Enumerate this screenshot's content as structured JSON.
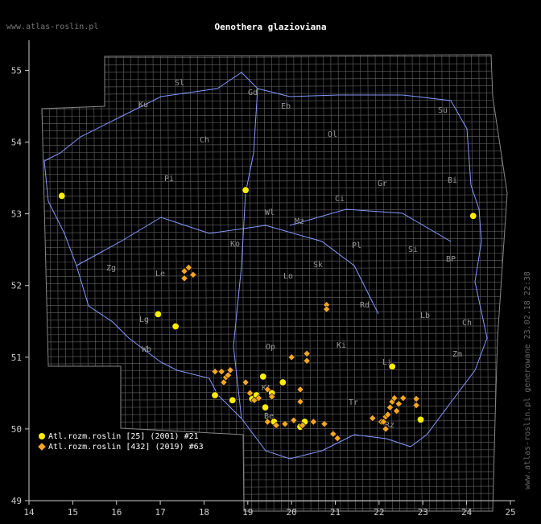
{
  "header": {
    "site": "www.atlas-roslin.pl",
    "title": "Oenothera glazioviana"
  },
  "side_note": "www.atlas-roslin.pl generowane 23.02.18 22:38",
  "axes": {
    "x_labels": [
      "14",
      "15",
      "16",
      "17",
      "18",
      "19",
      "20",
      "21",
      "22",
      "23",
      "24",
      "25"
    ],
    "y_labels": [
      "55",
      "54",
      "53",
      "52",
      "51",
      "50",
      "49"
    ]
  },
  "regions": [
    "Sl",
    "Gd",
    "Eb",
    "Ku",
    "Su",
    "Ch",
    "Ol",
    "Pi",
    "Ci",
    "Bi",
    "Gr",
    "Wl",
    "Mz",
    "Ko",
    "Pl",
    "Si",
    "Sk",
    "BP",
    "Zg",
    "Le",
    "Lo",
    "Rd",
    "Lb",
    "Ch",
    "Lg",
    "Wb",
    "Ki",
    "Zm",
    "Op",
    "Kt",
    "Tr",
    "Rz",
    "Be",
    "Li"
  ],
  "colors": {
    "grid": "#888888",
    "border": "#8899ff",
    "river": "#8899ff",
    "region_text": "#999999",
    "marker_old": "#ffee00",
    "marker_new": "#f5a623"
  },
  "legend": [
    {
      "label": "Atl.rozm.roslin [25] (2001) #21",
      "shape": "circle",
      "color": "#ffee00"
    },
    {
      "label": "Atl.rozm.roslin [432] (2019) #63",
      "shape": "diamond",
      "color": "#f5a623"
    }
  ],
  "points_circle": [
    [
      14.75,
      53.25
    ],
    [
      18.95,
      53.33
    ],
    [
      24.15,
      52.97
    ],
    [
      16.95,
      51.6
    ],
    [
      17.35,
      51.43
    ],
    [
      18.25,
      50.47
    ],
    [
      18.65,
      50.4
    ],
    [
      19.1,
      50.42
    ],
    [
      19.2,
      50.47
    ],
    [
      19.35,
      50.73
    ],
    [
      19.55,
      50.5
    ],
    [
      19.8,
      50.65
    ],
    [
      20.3,
      50.1
    ],
    [
      22.3,
      50.87
    ],
    [
      22.95,
      50.13
    ],
    [
      19.6,
      50.1
    ],
    [
      20.2,
      50.03
    ],
    [
      19.4,
      50.3
    ]
  ],
  "points_diamond": [
    [
      17.55,
      52.2
    ],
    [
      17.55,
      52.1
    ],
    [
      17.65,
      52.25
    ],
    [
      17.75,
      52.15
    ],
    [
      18.25,
      50.8
    ],
    [
      18.4,
      50.8
    ],
    [
      18.5,
      50.72
    ],
    [
      18.6,
      50.82
    ],
    [
      18.45,
      50.65
    ],
    [
      18.55,
      50.75
    ],
    [
      18.95,
      50.65
    ],
    [
      19.05,
      50.5
    ],
    [
      19.15,
      50.4
    ],
    [
      19.25,
      50.43
    ],
    [
      19.45,
      50.55
    ],
    [
      19.55,
      50.45
    ],
    [
      19.45,
      50.1
    ],
    [
      19.65,
      50.05
    ],
    [
      19.85,
      50.07
    ],
    [
      20.05,
      50.12
    ],
    [
      20.25,
      50.05
    ],
    [
      20.5,
      50.1
    ],
    [
      20.75,
      50.07
    ],
    [
      20.95,
      49.93
    ],
    [
      21.05,
      49.87
    ],
    [
      20.0,
      51.0
    ],
    [
      20.35,
      51.05
    ],
    [
      20.35,
      50.95
    ],
    [
      20.8,
      51.73
    ],
    [
      20.8,
      51.67
    ],
    [
      20.2,
      50.55
    ],
    [
      20.2,
      50.38
    ],
    [
      21.85,
      50.15
    ],
    [
      22.05,
      50.1
    ],
    [
      22.15,
      50.17
    ],
    [
      22.2,
      50.2
    ],
    [
      22.25,
      50.3
    ],
    [
      22.3,
      50.38
    ],
    [
      22.35,
      50.43
    ],
    [
      22.45,
      50.35
    ],
    [
      22.55,
      50.43
    ],
    [
      22.85,
      50.42
    ],
    [
      22.85,
      50.33
    ],
    [
      22.15,
      50.0
    ],
    [
      22.1,
      50.1
    ],
    [
      22.4,
      50.25
    ]
  ]
}
